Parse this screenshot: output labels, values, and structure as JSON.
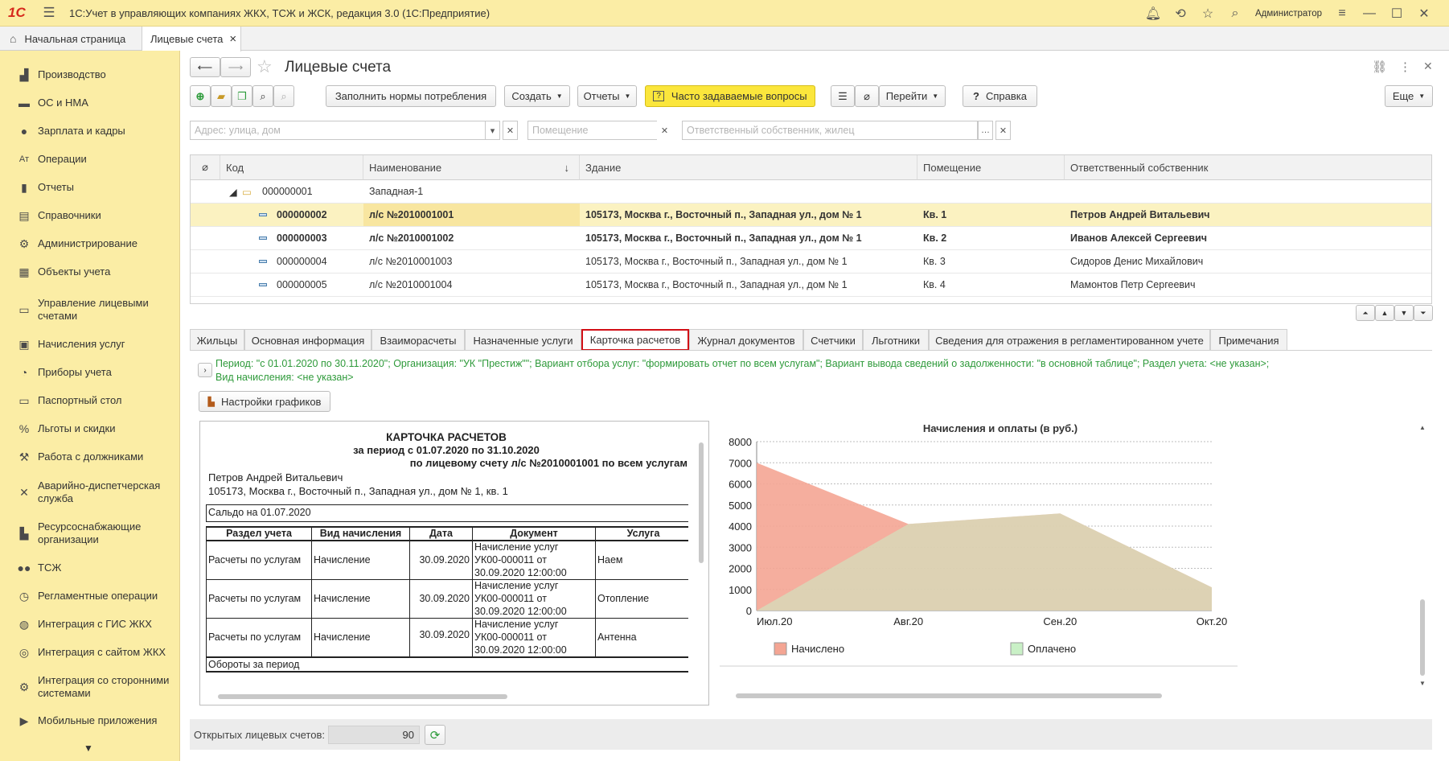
{
  "app": {
    "logo": "1С",
    "title": "1С:Учет в управляющих компаниях ЖКХ, ТСЖ и ЖСК, редакция 3.0  (1С:Предприятие)",
    "user": "Администратор"
  },
  "window_tabs": [
    {
      "label": "Начальная страница"
    },
    {
      "label": "Лицевые счета",
      "close": "×"
    }
  ],
  "sidebar": {
    "items": [
      {
        "label": "Производство",
        "icon": "factory-icon"
      },
      {
        "label": "ОС и НМА",
        "icon": "truck-icon"
      },
      {
        "label": "Зарплата и кадры",
        "icon": "person-icon"
      },
      {
        "label": "Операции",
        "icon": "operations-icon"
      },
      {
        "label": "Отчеты",
        "icon": "bar-chart-icon"
      },
      {
        "label": "Справочники",
        "icon": "book-icon"
      },
      {
        "label": "Администрирование",
        "icon": "gear-icon"
      },
      {
        "label": "Объекты учета",
        "icon": "building-icon"
      },
      {
        "label": "Управление лицевыми счетами",
        "icon": "card-icon"
      },
      {
        "label": "Начисления услуг",
        "icon": "calculator-icon"
      },
      {
        "label": "Приборы учета",
        "icon": "meter-icon"
      },
      {
        "label": "Паспортный стол",
        "icon": "passport-icon"
      },
      {
        "label": "Льготы и скидки",
        "icon": "percent-icon"
      },
      {
        "label": "Работа с должниками",
        "icon": "hammer-icon"
      },
      {
        "label": "Аварийно-диспетчерская служба",
        "icon": "tools-icon"
      },
      {
        "label": "Ресурсоснабжающие организации",
        "icon": "supply-icon"
      },
      {
        "label": "ТСЖ",
        "icon": "group-icon"
      },
      {
        "label": "Регламентные операции",
        "icon": "schedule-icon"
      },
      {
        "label": "Интеграция с ГИС ЖКХ",
        "icon": "gis-icon"
      },
      {
        "label": "Интеграция с сайтом ЖКХ",
        "icon": "globe-icon"
      },
      {
        "label": "Интеграция со сторонними системами",
        "icon": "integration-icon"
      },
      {
        "label": "Мобильные приложения",
        "icon": "mobile-icon"
      }
    ]
  },
  "form": {
    "title": "Лицевые счета",
    "toolbar": {
      "fill_norms": "Заполнить нормы потребления",
      "create": "Создать",
      "reports": "Отчеты",
      "faq": "Часто задаваемые вопросы",
      "goto": "Перейти",
      "help": "Справка",
      "more": "Еще"
    },
    "filters": {
      "address_placeholder": "Адрес: улица, дом",
      "room_placeholder": "Помещение",
      "owner_placeholder": "Ответственный собственник, жилец"
    }
  },
  "grid": {
    "columns": [
      "Код",
      "Наименование",
      "Здание",
      "Помещение",
      "Ответственный собственник"
    ],
    "group": {
      "code": "000000001",
      "name": "Западная-1"
    },
    "rows": [
      {
        "code": "000000002",
        "name": "л/с №2010001001",
        "building": "105173, Москва г., Восточный п., Западная ул., дом № 1",
        "room": "Кв. 1",
        "owner": "Петров Андрей Витальевич"
      },
      {
        "code": "000000003",
        "name": "л/с №2010001002",
        "building": "105173, Москва г., Восточный п., Западная ул., дом № 1",
        "room": "Кв. 2",
        "owner": "Иванов Алексей Сергеевич"
      },
      {
        "code": "000000004",
        "name": "л/с №2010001003",
        "building": "105173, Москва г., Восточный п., Западная ул., дом № 1",
        "room": "Кв. 3",
        "owner": "Сидоров Денис Михайлович"
      },
      {
        "code": "000000005",
        "name": "л/с №2010001004",
        "building": "105173, Москва г., Восточный п., Западная ул., дом № 1",
        "room": "Кв. 4",
        "owner": "Мамонтов Петр Сергеевич"
      }
    ]
  },
  "bottom_tabs": [
    "Жильцы",
    "Основная информация",
    "Взаиморасчеты",
    "Назначенные услуги",
    "Карточка расчетов",
    "Журнал документов",
    "Счетчики",
    "Льготники",
    "Сведения для отражения в регламентированном учете",
    "Примечания"
  ],
  "settings_line1": "Период: \"с 01.01.2020 по 30.11.2020\"; Организация: \"УК \"Престиж\"\"; Вариант отбора услуг: \"формировать отчет по всем услугам\"; Вариант вывода сведений о задолженности: \"в основной таблице\"; Раздел учета: <не указан>;",
  "settings_line2": "Вид начисления: <не указан>",
  "chart_settings_button": "Настройки графиков",
  "report": {
    "title": "КАРТОЧКА РАСЧЕТОВ",
    "period": "за период с 01.07.2020 по 31.10.2020",
    "account": "по лицевому счету л/с №2010001001 по всем услугам",
    "person": "Петров Андрей Витальевич",
    "address": "105173, Москва г., Восточный п., Западная ул., дом № 1, кв. 1",
    "opening_balance": "Сальдо на 01.07.2020",
    "headers": [
      "Раздел учета",
      "Вид начисления",
      "Дата",
      "Документ",
      "Услуга"
    ],
    "rows": [
      {
        "section": "Расчеты по услугам",
        "kind": "Начисление",
        "date": "30.09.2020",
        "doc1": "Начисление услуг",
        "doc2": "УК00-000011 от",
        "doc3": "30.09.2020 12:00:00",
        "service": "Наем"
      },
      {
        "section": "Расчеты по услугам",
        "kind": "Начисление",
        "date": "30.09.2020",
        "doc1": "Начисление услуг",
        "doc2": "УК00-000011 от",
        "doc3": "30.09.2020 12:00:00",
        "service": "Отопление"
      },
      {
        "section": "Расчеты по услугам",
        "kind": "Начисление",
        "date": "30.09.2020",
        "doc1": "Начисление услуг",
        "doc2": "УК00-000011 от",
        "doc3": "30.09.2020 12:00:00",
        "service": "Антенна"
      }
    ],
    "turnover": "Обороты за период"
  },
  "chart_data": {
    "type": "area",
    "title": "Начисления и оплаты (в руб.)",
    "categories": [
      "Июл.20",
      "Авг.20",
      "Сен.20",
      "Окт.20"
    ],
    "ylim": [
      0,
      8000
    ],
    "yticks": [
      0,
      1000,
      2000,
      3000,
      4000,
      5000,
      6000,
      7000,
      8000
    ],
    "grid": true,
    "legend_position": "bottom",
    "series": [
      {
        "name": "Начислено",
        "values": [
          7000,
          4100,
          4600,
          1100
        ],
        "color": "#f4a593"
      },
      {
        "name": "Оплачено",
        "values": [
          0,
          4100,
          4600,
          1100
        ],
        "color": "#c9f0c6"
      }
    ]
  },
  "footer": {
    "label": "Открытых лицевых счетов:",
    "count": "90"
  },
  "colors": {
    "titlebar_bg": "#fbeda5",
    "selection_bg": "#fbf2c1",
    "active_tab_border": "#d20f16",
    "faq_button": "#fbe63c",
    "settings_text": "#2e9a3a"
  }
}
